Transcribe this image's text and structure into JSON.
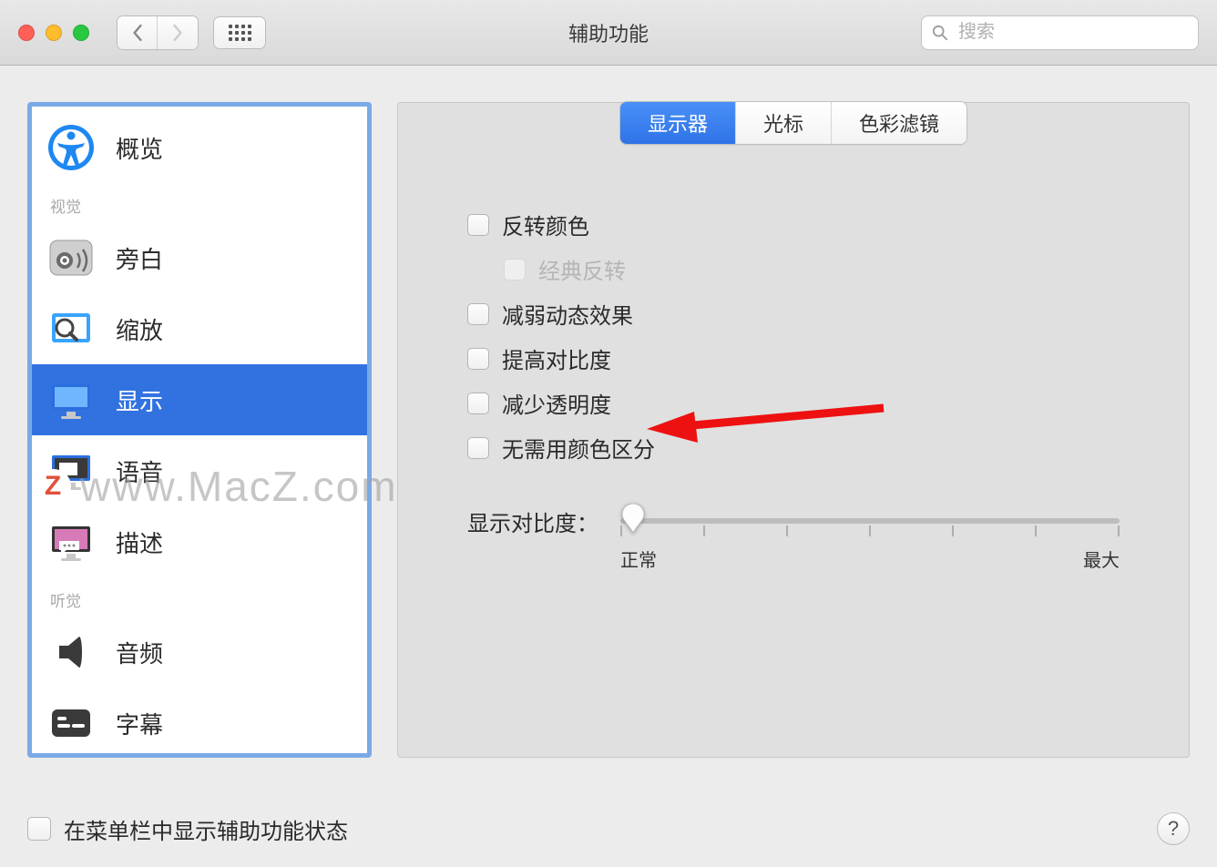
{
  "window": {
    "title": "辅助功能"
  },
  "toolbar": {
    "search_placeholder": "搜索"
  },
  "sidebar": {
    "groups": [
      {
        "label": "",
        "items": [
          {
            "label": "概览",
            "icon": "accessibility"
          }
        ]
      },
      {
        "label": "视觉",
        "items": [
          {
            "label": "旁白",
            "icon": "voiceover"
          },
          {
            "label": "缩放",
            "icon": "zoom"
          },
          {
            "label": "显示",
            "icon": "display",
            "selected": true
          },
          {
            "label": "语音",
            "icon": "speech"
          },
          {
            "label": "描述",
            "icon": "descriptions"
          }
        ]
      },
      {
        "label": "听觉",
        "items": [
          {
            "label": "音频",
            "icon": "audio"
          },
          {
            "label": "字幕",
            "icon": "captions"
          }
        ]
      }
    ]
  },
  "tabs": {
    "items": [
      "显示器",
      "光标",
      "色彩滤镜"
    ],
    "active_index": 0
  },
  "options": {
    "invert_colors": {
      "label": "反转颜色",
      "checked": false
    },
    "classic_invert": {
      "label": "经典反转",
      "checked": false,
      "disabled": true
    },
    "reduce_motion": {
      "label": "减弱动态效果",
      "checked": false
    },
    "increase_contrast": {
      "label": "提高对比度",
      "checked": false
    },
    "reduce_transparency": {
      "label": "减少透明度",
      "checked": false
    },
    "differentiate_without_color": {
      "label": "无需用颜色区分",
      "checked": false
    }
  },
  "contrast_slider": {
    "label": "显示对比度：",
    "min_label": "正常",
    "max_label": "最大",
    "value": 0
  },
  "footer": {
    "menubar_status_label": "在菜单栏中显示辅助功能状态",
    "menubar_status_checked": false,
    "help_label": "?"
  },
  "watermark": "www.MacZ.com"
}
